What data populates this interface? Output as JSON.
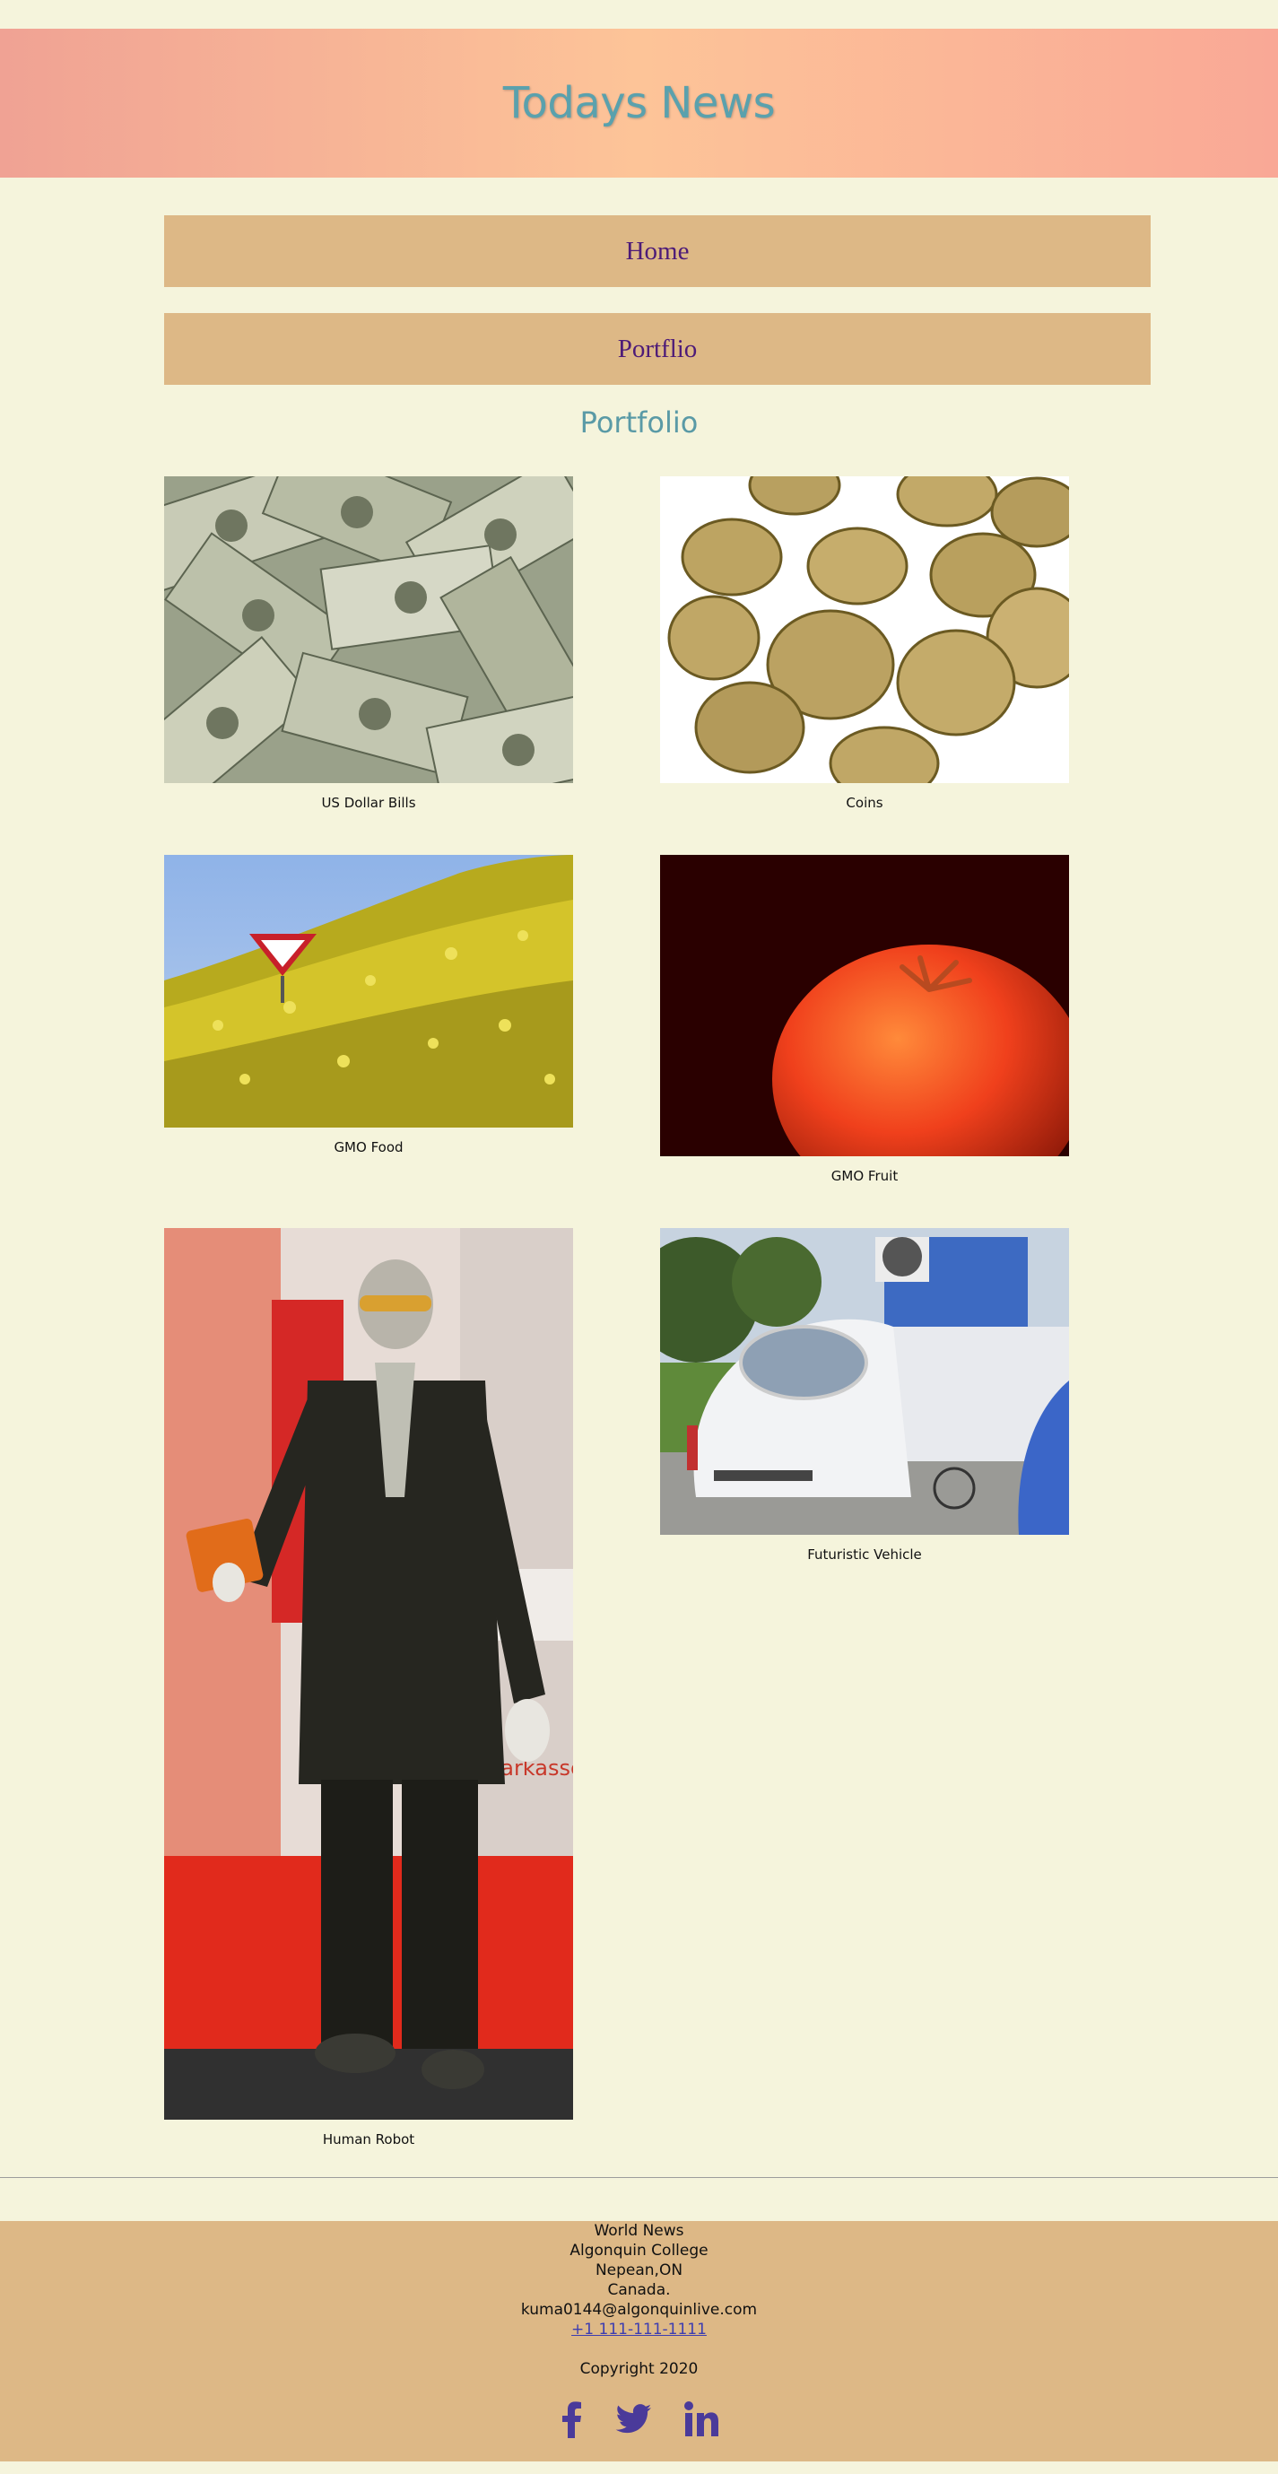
{
  "header": {
    "title": "Todays News"
  },
  "nav": {
    "home": "Home",
    "portfolio": "Portflio"
  },
  "section": {
    "title": "Portfolio"
  },
  "portfolio": [
    {
      "caption": "US Dollar Bills"
    },
    {
      "caption": "Coins"
    },
    {
      "caption": "GMO Food"
    },
    {
      "caption": "GMO Fruit"
    },
    {
      "caption": "Human Robot"
    },
    {
      "caption": "Futuristic Vehicle"
    }
  ],
  "footer": {
    "name": "World News",
    "college": "Algonquin College",
    "city": "Nepean,ON",
    "country": "Canada.",
    "email": "kuma0144@algonquinlive.com",
    "phone": "+1 111-111-1111",
    "copyright": "Copyright 2020"
  },
  "social": [
    "facebook-icon",
    "twitter-icon",
    "linkedin-icon"
  ],
  "colors": {
    "page_bg": "#f5f4dc",
    "nav_bg": "#ddb886",
    "nav_text": "#4d1b78",
    "title": "#5aa1ad",
    "social": "#4a3a9a"
  }
}
